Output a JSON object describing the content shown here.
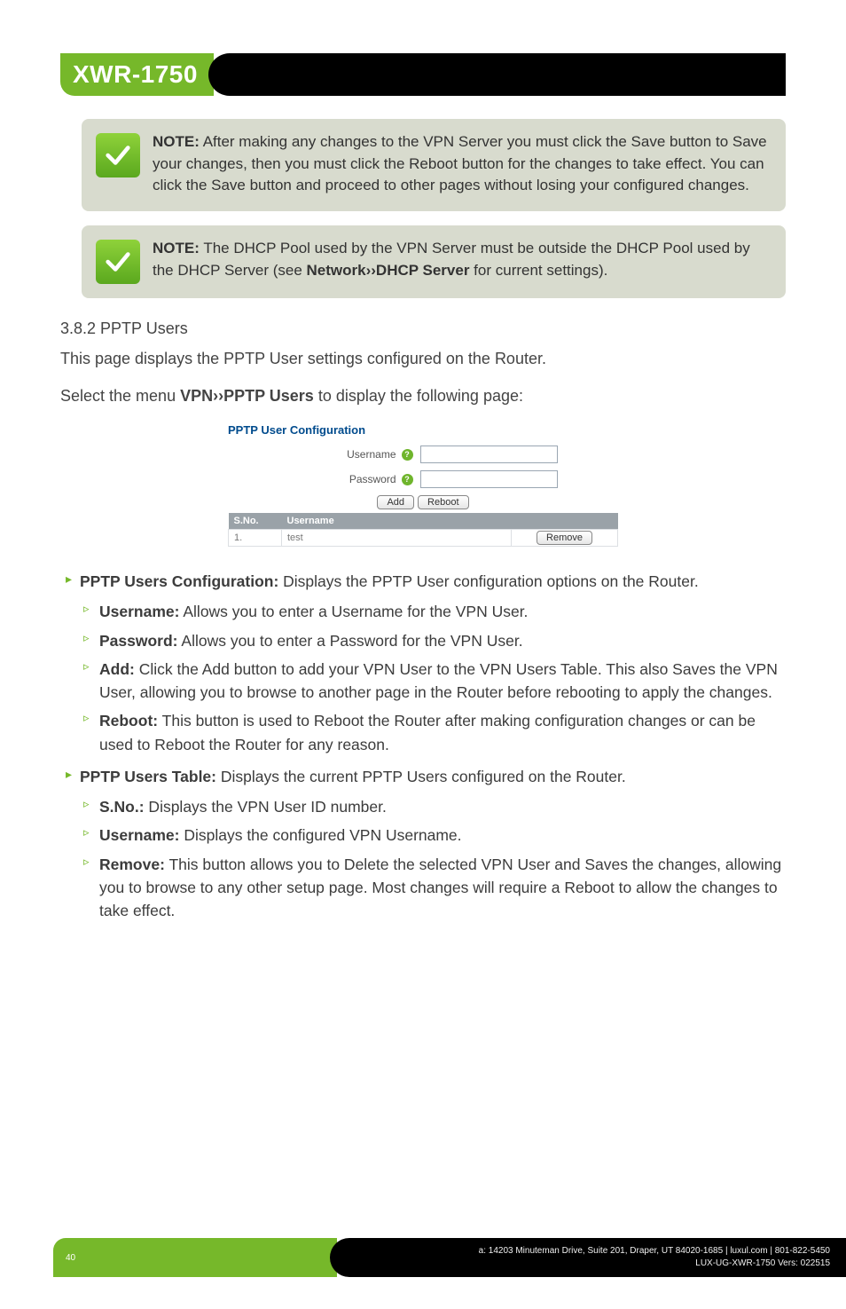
{
  "product": "XWR-1750",
  "notes": [
    {
      "label": "NOTE:",
      "text": "After making any changes to the VPN Server you must click the Save button to Save your changes, then you must click the Reboot button for the changes to take effect. You can click the Save button and proceed to other pages without losing your configured changes."
    },
    {
      "label": "NOTE:",
      "text_pre": "The DHCP Pool used by the VPN Server must be outside the DHCP Pool used by the DHCP Server (see ",
      "bold": "Network››DHCP Server",
      "text_post": " for current settings)."
    }
  ],
  "section": {
    "number": "3.8.2 PPTP Users",
    "intro": "This page displays the PPTP User settings configured on the Router.",
    "intro2_pre": "Select the menu ",
    "intro2_bold": "VPN››PPTP Users",
    "intro2_post": " to display the following page:"
  },
  "screenshot": {
    "title": "PPTP User Configuration",
    "username_label": "Username",
    "password_label": "Password",
    "add": "Add",
    "reboot": "Reboot",
    "th_sno": "S.No.",
    "th_user": "Username",
    "row_index": "1.",
    "row_user": "test",
    "remove": "Remove"
  },
  "list": {
    "pptp_config_label": "PPTP Users Configuration:",
    "pptp_config_text": " Displays the PPTP User configuration options on the Router.",
    "username_l": "Username:",
    "username_t": " Allows you to enter a Username for the VPN User.",
    "password_l": "Password:",
    "password_t": " Allows you to enter a Password for the VPN User.",
    "add_l": "Add:",
    "add_t": " Click the Add button to add your VPN User to the VPN Users Table. This also Saves the VPN User, allowing you to browse to another page in the Router before rebooting to apply the changes.",
    "reboot_l": "Reboot:",
    "reboot_t": " This button is used to Reboot the Router after making configuration changes or can be used to Reboot the Router for any reason.",
    "pptp_table_label": "PPTP Users Table:",
    "pptp_table_text": " Displays the current PPTP Users configured on the Router.",
    "sno_l": "S.No.:",
    "sno_t": " Displays the VPN User ID number.",
    "tuser_l": "Username:",
    "tuser_t": " Displays the configured VPN Username.",
    "remove_l": "Remove:",
    "remove_t": " This button allows you to Delete the selected VPN User and Saves the changes, allowing you to browse to any other setup page. Most changes will require a Reboot to allow the changes to take effect."
  },
  "footer": {
    "page": "40",
    "addr": "a: 14203 Minuteman Drive, Suite 201, Draper, UT 84020-1685 | luxul.com | 801-822-5450",
    "doc": "LUX-UG-XWR-1750  Vers: 022515"
  }
}
